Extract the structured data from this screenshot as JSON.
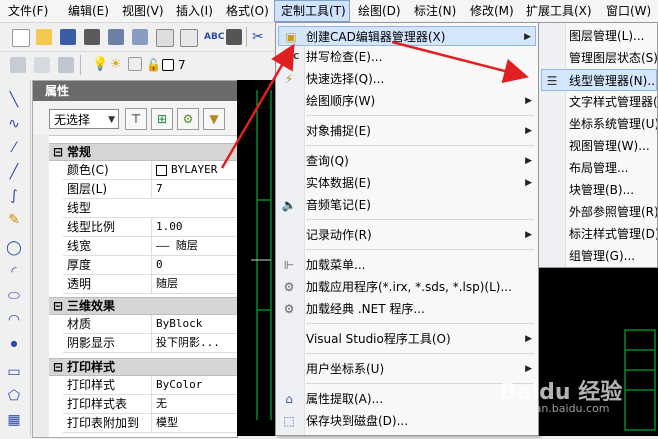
{
  "menubar": {
    "items": [
      "文件(F)",
      "编辑(E)",
      "视图(V)",
      "插入(I)",
      "格式(O)",
      "定制工具(T)",
      "绘图(D)",
      "标注(N)",
      "修改(M)",
      "扩展工具(X)",
      "窗口(W)"
    ]
  },
  "toolbar2": {
    "layer_value": "7"
  },
  "props": {
    "title": "属性",
    "selection": "无选择",
    "sections": {
      "general": "常规",
      "effects3d": "三维效果",
      "plotstyle": "打印样式"
    },
    "general_rows": [
      {
        "k": "颜色(C)",
        "v": "BYLAYER"
      },
      {
        "k": "图层(L)",
        "v": "7"
      },
      {
        "k": "线型",
        "v": ""
      },
      {
        "k": "线型比例",
        "v": "1.00"
      },
      {
        "k": "线宽",
        "v": "—— 随层"
      },
      {
        "k": "厚度",
        "v": "0"
      },
      {
        "k": "透明",
        "v": "随层"
      }
    ],
    "effects_rows": [
      {
        "k": "材质",
        "v": "ByBlock"
      },
      {
        "k": "阴影显示",
        "v": "投下阴影..."
      }
    ],
    "plot_rows": [
      {
        "k": "打印样式",
        "v": "ByColor"
      },
      {
        "k": "打印样式表",
        "v": "无"
      },
      {
        "k": "打印表附加到",
        "v": "模型"
      }
    ]
  },
  "menu": {
    "items": [
      {
        "label": "创建CAD编辑器管理器(X)",
        "icon": "folder-gear-icon"
      },
      {
        "label": "拼写检查(E)...",
        "icon": "abc-spell-icon"
      },
      {
        "label": "快速选择(Q)...",
        "icon": "quick-select-icon"
      },
      {
        "label": "绘图顺序(W)",
        "icon": ""
      },
      {
        "label": "对象捕捉(E)",
        "icon": ""
      },
      {
        "label": "查询(Q)",
        "icon": ""
      },
      {
        "label": "实体数据(E)",
        "icon": ""
      },
      {
        "label": "音频笔记(E)",
        "icon": "speaker-icon"
      },
      {
        "label": "记录动作(R)",
        "icon": ""
      },
      {
        "label": "加载菜单...",
        "icon": "menu-load-icon"
      },
      {
        "label": "加载应用程序(*.irx, *.sds, *.lsp)(L)...",
        "icon": "gear-load-icon"
      },
      {
        "label": "加载经典 .NET 程序...",
        "icon": "gear-net-icon"
      },
      {
        "label": "Visual Studio程序工具(O)",
        "icon": ""
      },
      {
        "label": "用户坐标系(U)",
        "icon": ""
      },
      {
        "label": "属性提取(A)...",
        "icon": "attribute-extract-icon"
      },
      {
        "label": "保存块到磁盘(D)...",
        "icon": "save-block-icon"
      }
    ]
  },
  "submenu": {
    "items": [
      "图层管理(L)...",
      "管理图层状态(S)...",
      "线型管理器(N)...",
      "文字样式管理器(S)...",
      "坐标系统管理(U)...",
      "视图管理(W)...",
      "布局管理...",
      "块管理(B)...",
      "外部参照管理(R)...",
      "标注样式管理(D)...",
      "组管理(G)..."
    ]
  },
  "watermark": {
    "main": "Baidu 经验",
    "sub": "jingyan.baidu.com"
  },
  "colors": {
    "arrow": "#e02020",
    "highlight": "#d4e6fb",
    "canvas_line": "#00cc44"
  }
}
